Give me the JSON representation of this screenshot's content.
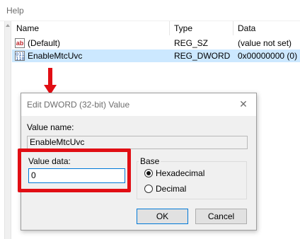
{
  "menubar": {
    "help_label": "Help"
  },
  "list": {
    "columns": {
      "name": "Name",
      "type": "Type",
      "data": "Data"
    },
    "rows": [
      {
        "icon": "string-value-icon",
        "icon_glyph": "ab",
        "name": "(Default)",
        "type": "REG_SZ",
        "data": "(value not set)"
      },
      {
        "icon": "binary-value-icon",
        "icon_glyph": "011\n110",
        "name": "EnableMtcUvc",
        "type": "REG_DWORD",
        "data": "0x00000000 (0)"
      }
    ]
  },
  "dialog": {
    "title": "Edit DWORD (32-bit) Value",
    "close_glyph": "✕",
    "value_name_label": "Value name:",
    "value_name": "EnableMtcUvc",
    "value_data_label": "Value data:",
    "value_data": "0",
    "base_label": "Base",
    "base_options": [
      {
        "label": "Hexadecimal",
        "selected": true
      },
      {
        "label": "Decimal",
        "selected": false
      }
    ],
    "ok_label": "OK",
    "cancel_label": "Cancel"
  },
  "colors": {
    "selection": "#cce8ff",
    "annotation_red": "#e10e14",
    "focus_blue": "#0078d7"
  }
}
